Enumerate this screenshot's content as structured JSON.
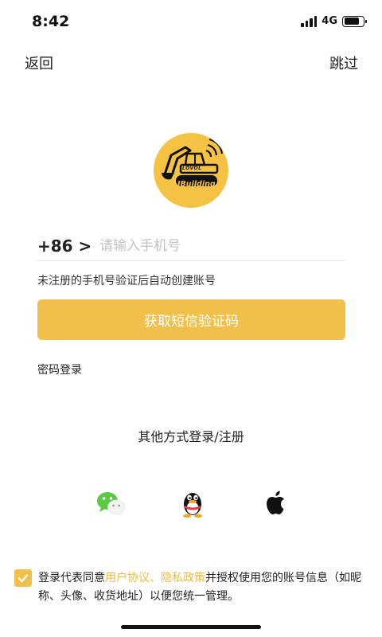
{
  "status_bar": {
    "time": "8:42",
    "network": "4G"
  },
  "nav": {
    "back_label": "返回",
    "skip_label": "跳过"
  },
  "logo": {
    "small_text": "LOVOL",
    "brand_text": "IBuilding",
    "bg_color": "#f5c243"
  },
  "login_form": {
    "country_code": "+86 >",
    "phone_placeholder": "请输入手机号",
    "phone_value": "",
    "hint": "未注册的手机号验证后自动创建账号",
    "sms_button_label": "获取短信验证码",
    "password_login_label": "密码登录"
  },
  "other_login": {
    "title": "其他方式登录/注册",
    "methods": [
      "wechat-icon",
      "qq-icon",
      "apple-icon"
    ]
  },
  "agreement": {
    "checked": true,
    "prefix": "登录代表同意",
    "user_agreement": "用户协议",
    "separator": "、",
    "privacy_policy": "隐私政策",
    "suffix": "并授权使用您的账号信息（如昵称、头像、收货地址）以便您统一管理。"
  },
  "colors": {
    "accent": "#f1c04b",
    "link": "#f1b93b",
    "text": "#222222",
    "placeholder": "#c2c2c2"
  }
}
